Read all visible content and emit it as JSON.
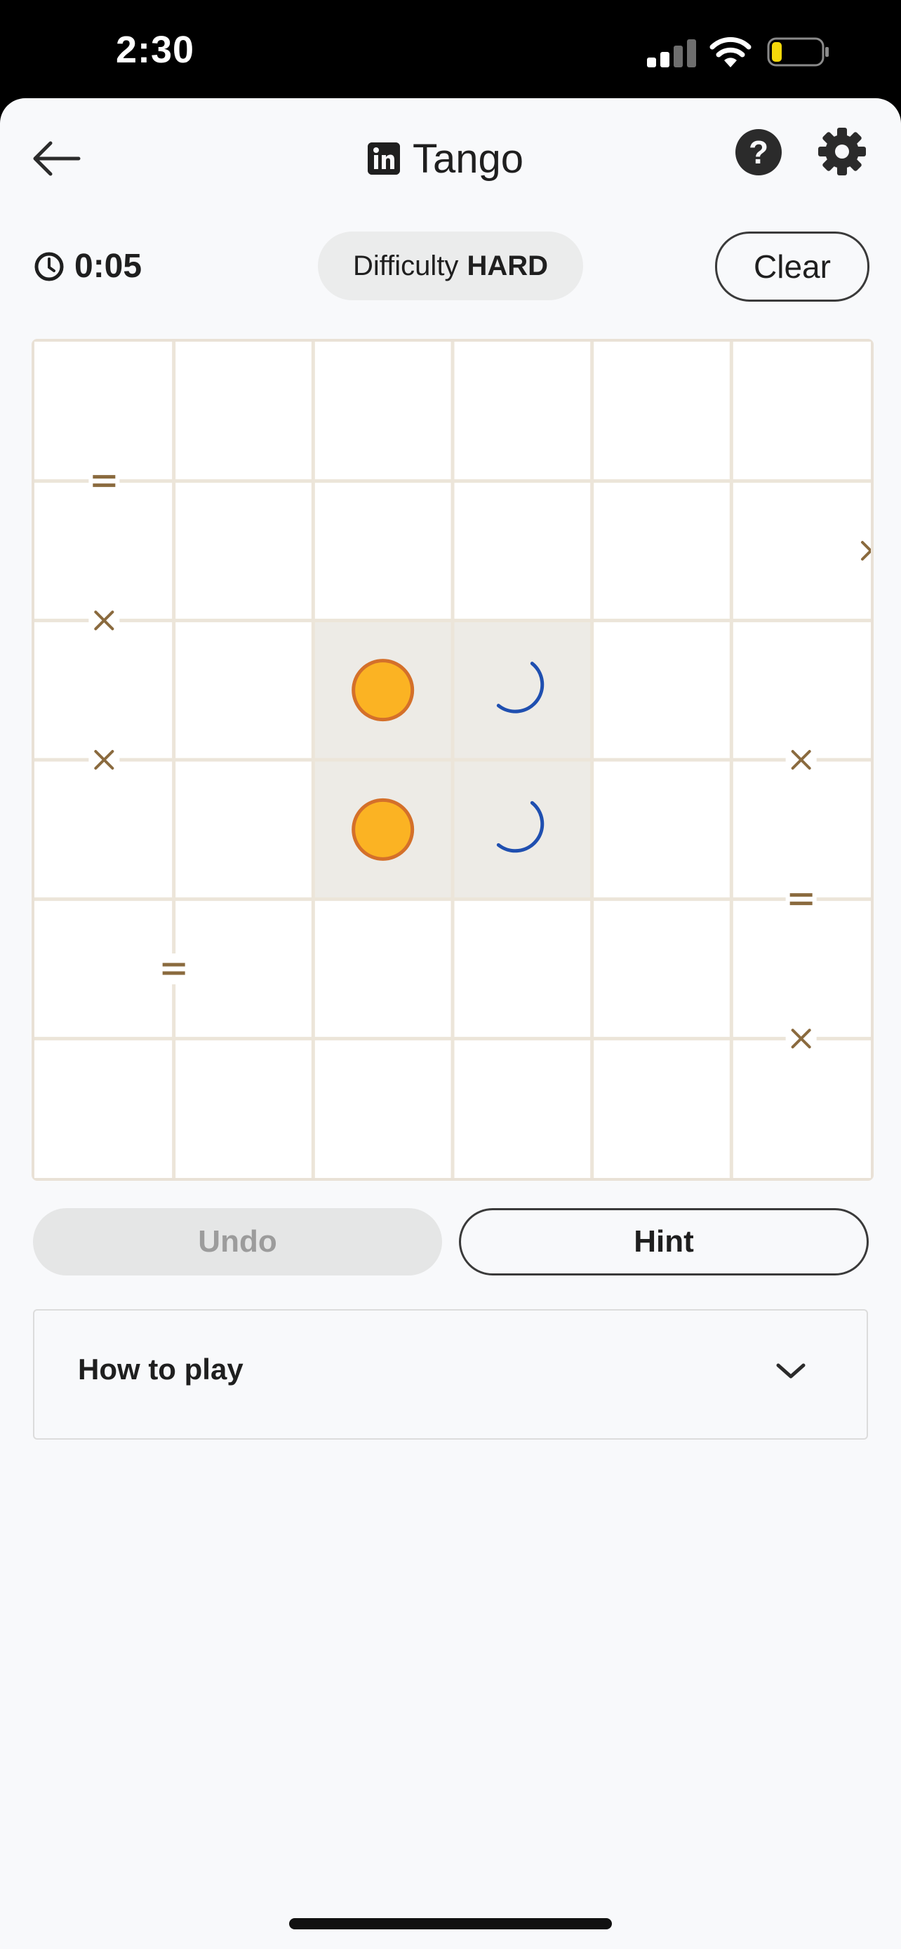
{
  "status_bar": {
    "time": "2:30",
    "battery_color": "#f5d90a"
  },
  "header": {
    "title": "Tango"
  },
  "controls": {
    "timer": "0:05",
    "difficulty_label": "Difficulty",
    "difficulty_level": "HARD",
    "clear_label": "Clear"
  },
  "board": {
    "rows": 6,
    "cols": 6,
    "cells": [
      {
        "row": 2,
        "col": 2,
        "symbol": "sun",
        "locked": true
      },
      {
        "row": 2,
        "col": 3,
        "symbol": "moon",
        "locked": true
      },
      {
        "row": 3,
        "col": 2,
        "symbol": "sun",
        "locked": true
      },
      {
        "row": 3,
        "col": 3,
        "symbol": "moon",
        "locked": true
      }
    ],
    "constraints": [
      {
        "between": [
          [
            0,
            0
          ],
          [
            1,
            0
          ]
        ],
        "type": "="
      },
      {
        "between": [
          [
            1,
            5
          ],
          [
            1,
            6
          ]
        ],
        "type": "×"
      },
      {
        "between": [
          [
            1,
            0
          ],
          [
            2,
            0
          ]
        ],
        "type": "×"
      },
      {
        "between": [
          [
            2,
            0
          ],
          [
            3,
            0
          ]
        ],
        "type": "×"
      },
      {
        "between": [
          [
            2,
            5
          ],
          [
            3,
            5
          ]
        ],
        "type": "×"
      },
      {
        "between": [
          [
            3,
            5
          ],
          [
            4,
            5
          ]
        ],
        "type": "="
      },
      {
        "between": [
          [
            4,
            0
          ],
          [
            4,
            1
          ]
        ],
        "type": "="
      },
      {
        "between": [
          [
            4,
            5
          ],
          [
            5,
            5
          ]
        ],
        "type": "×"
      }
    ],
    "colors": {
      "sun": "#fbb323",
      "sun_outline": "#d4702a",
      "moon": "#3d7de0",
      "moon_outline": "#1f4fb0",
      "locked_bg": "#edebe6",
      "grid": "#ece5d9",
      "constraint": "#8a6a3e"
    }
  },
  "actions": {
    "undo_label": "Undo",
    "hint_label": "Hint"
  },
  "how_to_play": {
    "label": "How to play"
  }
}
